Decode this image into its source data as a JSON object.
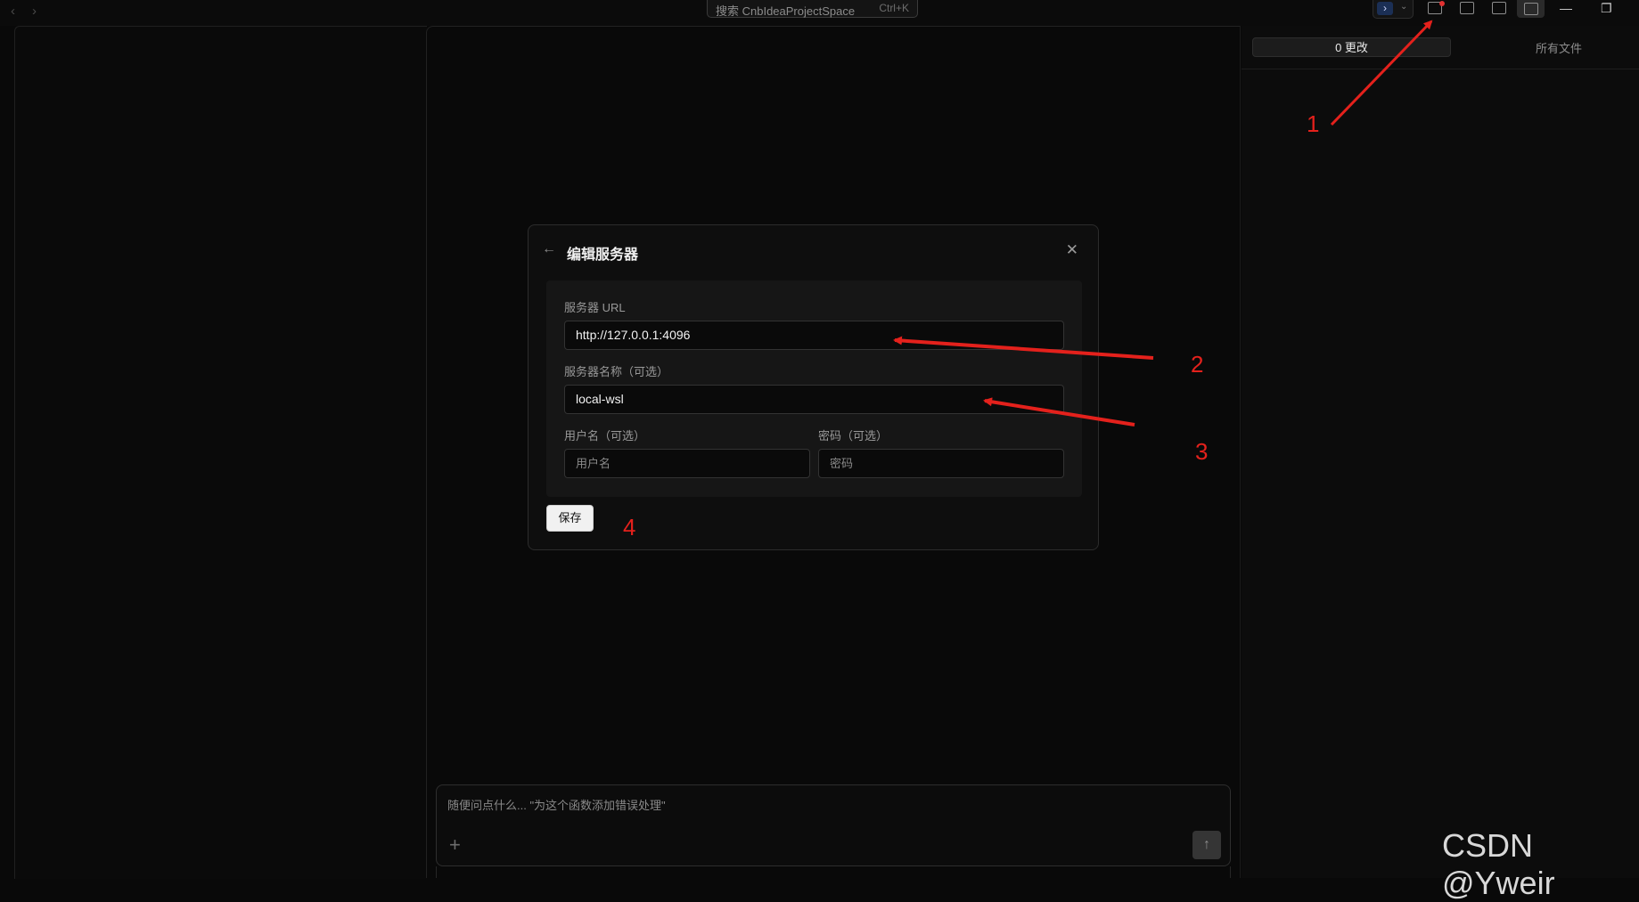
{
  "titlebar": {
    "nav_back": "‹",
    "nav_forward": "›",
    "search_label": "搜索 CnbIdeaProjectSpace",
    "search_shortcut": "Ctrl+K",
    "terminal_icon": "terminal-icon",
    "terminal_glyph": "⌄",
    "minimize": "—",
    "restore": "❐"
  },
  "right_panel": {
    "changes_tab": "0 更改",
    "files_tab": "所有文件"
  },
  "modal": {
    "back_icon": "←",
    "title": "编辑服务器",
    "close_icon": "✕",
    "url_label": "服务器 URL",
    "url_value": "http://127.0.0.1:4096",
    "name_label": "服务器名称（可选）",
    "name_value": "local-wsl",
    "username_label": "用户名（可选）",
    "username_placeholder": "用户名",
    "password_label": "密码（可选）",
    "password_placeholder": "密码",
    "save_button": "保存"
  },
  "chat": {
    "placeholder": "随便问点什么... \"为这个函数添加错误处理\"",
    "plus_icon": "+",
    "send_icon": "↑"
  },
  "annotations": {
    "n1": "1",
    "n2": "2",
    "n3": "3",
    "n4": "4",
    "color": "#e4211c"
  },
  "watermark": "CSDN @Yweir"
}
